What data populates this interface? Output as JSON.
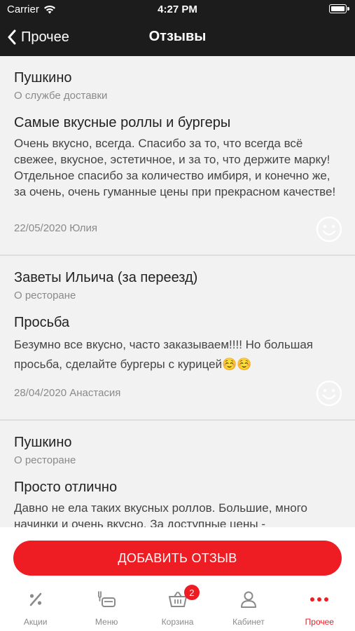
{
  "status_bar": {
    "carrier": "Carrier",
    "time": "4:27 PM"
  },
  "nav": {
    "back_label": "Прочее",
    "title": "Отзывы"
  },
  "reviews": [
    {
      "place": "Пушкино",
      "category": "О службе доставки",
      "title": "Самые вкусные роллы и бургеры",
      "text": "Очень вкусно, всегда. Спасибо за то, что всегда всё свежее, вкусное, эстетичное, и за то, что держите марку! Отдельное спасибо за количество имбиря, и конечно же, за очень, очень гуманные цены при прекрасном качестве!",
      "meta": "22/05/2020 Юлия",
      "icon": "smiley-icon"
    },
    {
      "place": "Заветы Ильича (за переезд)",
      "category": "О ресторане",
      "title": "Просьба",
      "text": "Безумно все вкусно, часто заказываем!!!! Но большая просьба, сделайте бургеры с курицей☺️☺️",
      "meta": "28/04/2020 Анастасия",
      "icon": "smiley-icon"
    },
    {
      "place": "Пушкино",
      "category": "О ресторане",
      "title": "Просто отлично",
      "text": "Давно не ела таких вкусных роллов. Большие, много начинки и очень вкусно. За доступные цены -",
      "meta": "",
      "icon": "smiley-icon"
    }
  ],
  "add_review_button": "ДОБАВИТЬ ОТЗЫВ",
  "tabs": [
    {
      "label": "Акции",
      "icon": "percent-icon",
      "active": false
    },
    {
      "label": "Меню",
      "icon": "menu-food-icon",
      "active": false
    },
    {
      "label": "Корзина",
      "icon": "basket-icon",
      "active": false,
      "badge": "2"
    },
    {
      "label": "Кабинет",
      "icon": "user-icon",
      "active": false
    },
    {
      "label": "Прочее",
      "icon": "more-dots-icon",
      "active": true
    }
  ],
  "colors": {
    "accent": "#ee1d23",
    "header_bg": "#1c1c1c",
    "background": "#f2f2f2"
  }
}
